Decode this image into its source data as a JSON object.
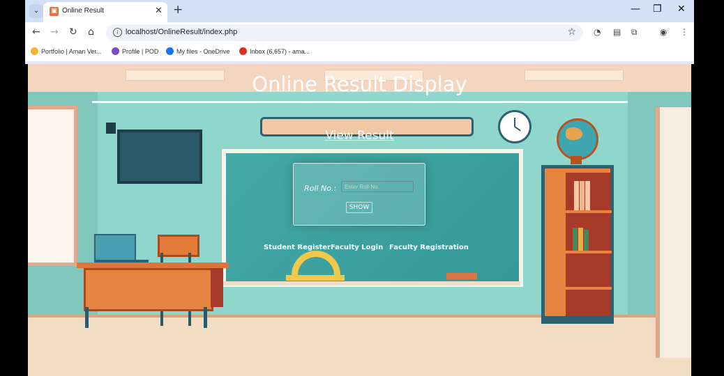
{
  "browser": {
    "tab_title": "Online Result",
    "url": "localhost/OnlineResult/index.php",
    "bookmarks": [
      {
        "label": "Portfolio | Aman Ver...",
        "color": "#f1b531"
      },
      {
        "label": "Profile | POD",
        "color": "#7b4bc4"
      },
      {
        "label": "My files - OneDrive",
        "color": "#1a73e8"
      },
      {
        "label": "Inbox (6,657) - ama...",
        "color": "#d93025"
      }
    ]
  },
  "page": {
    "title": "Online Result Display",
    "view_link": "View Result",
    "form": {
      "roll_label": "Roll No.:",
      "roll_placeholder": "Enter Roll No.",
      "show_button": "SHOW"
    },
    "footer_links": [
      "Student Register",
      "Faculty Login",
      "Faculty Registration"
    ]
  }
}
